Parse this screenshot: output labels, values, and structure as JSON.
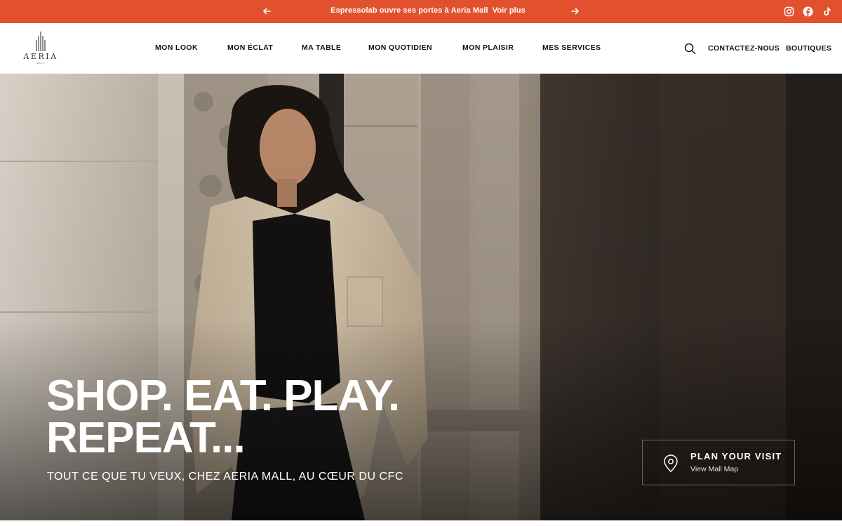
{
  "announcement": {
    "message": "Espressolab ouvre ses portes à Aeria Mall",
    "link": "Voir plus",
    "prev_icon": "arrow-left-icon",
    "next_icon": "arrow-right-icon",
    "background": "#e2512d",
    "social": [
      "instagram-icon",
      "facebook-icon",
      "tiktok-icon"
    ]
  },
  "header": {
    "logo_text": "AERIA",
    "logo_sub": "MALL",
    "nav": [
      "MON LOOK",
      "MON ÉCLAT",
      "MA TABLE",
      "MON QUOTIDIEN",
      "MON PLAISIR",
      "MES SERVICES"
    ],
    "search_icon": "search-icon",
    "contact": "CONTACTEZ-NOUS",
    "stores": "BOUTIQUES"
  },
  "hero": {
    "title_line1": "SHOP. EAT. PLAY.",
    "title_line2": "REPEAT...",
    "subtitle": "TOUT CE QUE TU VEUX, CHEZ AERIA MALL, AU CŒUR DU CFC",
    "visit": {
      "title": "PLAN YOUR VISIT",
      "subtitle": "View Mall Map",
      "icon": "map-pin-icon"
    }
  }
}
